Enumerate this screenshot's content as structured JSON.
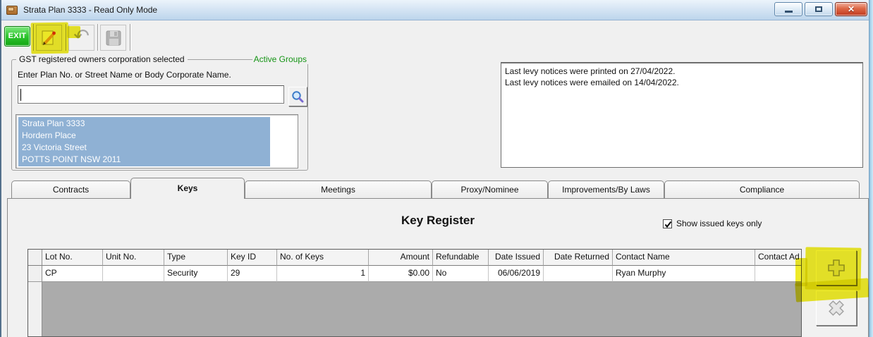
{
  "window": {
    "title": "Strata Plan 3333 - Read Only Mode",
    "app_icon": "folder-icon",
    "controls": [
      {
        "name": "minimize"
      },
      {
        "name": "maximize"
      },
      {
        "name": "close"
      }
    ]
  },
  "toolbar": {
    "exit_label": "EXIT",
    "buttons": [
      {
        "name": "edit",
        "highlighted": true
      },
      {
        "name": "undo",
        "disabled": true
      },
      {
        "name": "save",
        "disabled": true
      }
    ]
  },
  "search_panel": {
    "legend": "GST registered owners corporation selected",
    "active_groups_label": "Active Groups",
    "prompt": "Enter Plan No. or Street Name or Body Corporate Name.",
    "search_value": "",
    "selected_plan_lines": [
      "Strata Plan 3333",
      "Hordern Place",
      "23 Victoria Street",
      "POTTS POINT  NSW  2011"
    ]
  },
  "notices": {
    "lines": [
      "Last levy notices were printed on 27/04/2022.",
      "Last levy notices were emailed on 14/04/2022."
    ]
  },
  "tabs": [
    {
      "label": "Contracts",
      "active": false
    },
    {
      "label": "Keys",
      "active": true
    },
    {
      "label": "Meetings",
      "active": false
    },
    {
      "label": "Proxy/Nominee",
      "active": false
    },
    {
      "label": "Improvements/By Laws",
      "active": false
    },
    {
      "label": "Compliance",
      "active": false
    }
  ],
  "key_register": {
    "title": "Key Register",
    "filter_label": "Show issued keys only",
    "filter_checked": true,
    "table": {
      "columns": [
        "",
        "Lot No.",
        "Unit No.",
        "Type",
        "Key ID",
        "No. of Keys",
        "Amount",
        "Refundable",
        "Date Issued",
        "Date Returned",
        "Contact Name",
        "Contact Ad"
      ],
      "rows": [
        [
          "",
          "CP",
          "",
          "Security",
          "29",
          "1",
          "$0.00",
          "No",
          "06/06/2019",
          "",
          "Ryan Murphy",
          ""
        ]
      ]
    },
    "actions": [
      {
        "name": "add-key",
        "glyph": "plus"
      },
      {
        "name": "delete-key",
        "glyph": "cross"
      }
    ]
  },
  "colors": {
    "marker_yellow": "#eeea16",
    "selection_blue": "#8fb1d4",
    "active_groups_green": "#159415",
    "exit_green": "#12a412"
  }
}
